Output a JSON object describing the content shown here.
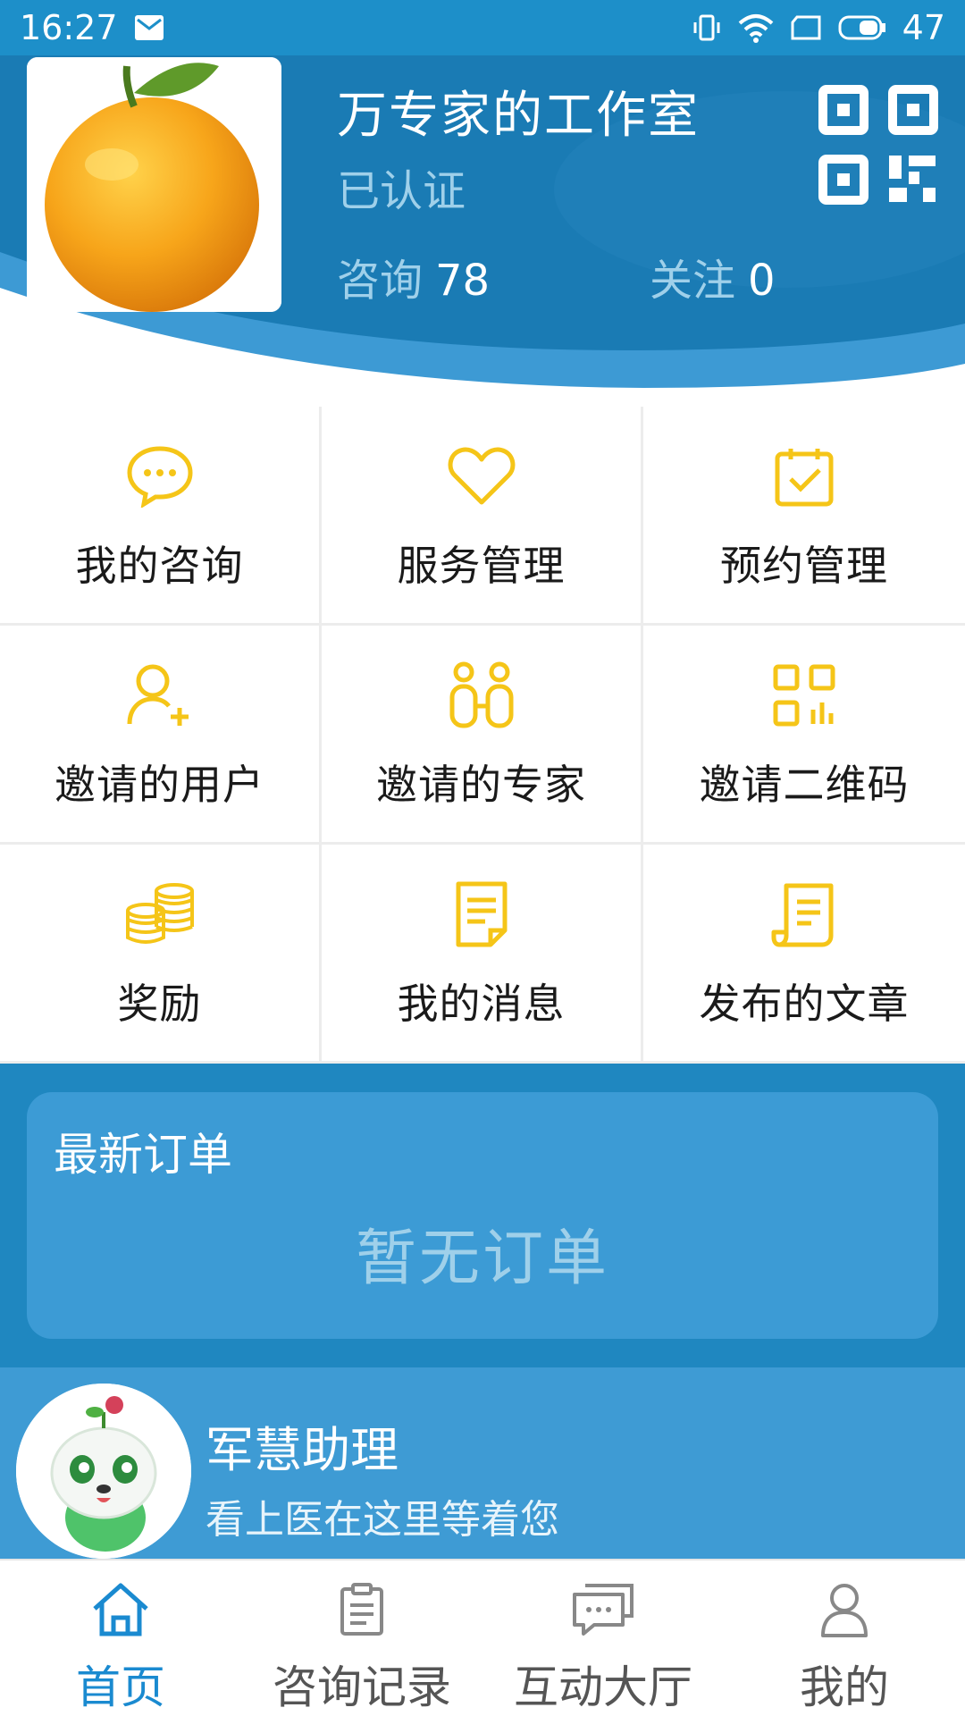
{
  "status_bar": {
    "time": "16:27",
    "battery": "47"
  },
  "header": {
    "studio_name": "万专家的工作室",
    "verified": "已认证",
    "consult_label": "咨询",
    "consult_count": "78",
    "follow_label": "关注",
    "follow_count": "0"
  },
  "grid": [
    {
      "label": "我的咨询",
      "icon": "chat-bubble-icon"
    },
    {
      "label": "服务管理",
      "icon": "heart-icon"
    },
    {
      "label": "预约管理",
      "icon": "calendar-check-icon"
    },
    {
      "label": "邀请的用户",
      "icon": "add-user-icon"
    },
    {
      "label": "邀请的专家",
      "icon": "experts-icon"
    },
    {
      "label": "邀请二维码",
      "icon": "qr-code-icon"
    },
    {
      "label": "奖励",
      "icon": "coins-icon"
    },
    {
      "label": "我的消息",
      "icon": "message-doc-icon"
    },
    {
      "label": "发布的文章",
      "icon": "article-scroll-icon"
    }
  ],
  "orders": {
    "title": "最新订单",
    "empty_text": "暂无订单"
  },
  "assistant": {
    "name": "军慧助理",
    "subtitle": "看上医在这里等着您"
  },
  "nav": [
    {
      "label": "首页",
      "icon": "home-icon",
      "active": true
    },
    {
      "label": "咨询记录",
      "icon": "clipboard-icon",
      "active": false
    },
    {
      "label": "互动大厅",
      "icon": "chat-hall-icon",
      "active": false
    },
    {
      "label": "我的",
      "icon": "person-icon",
      "active": false
    }
  ],
  "colors": {
    "primary": "#1a7bb4",
    "accent_yellow": "#f5c518",
    "nav_active": "#1a8ad0"
  }
}
